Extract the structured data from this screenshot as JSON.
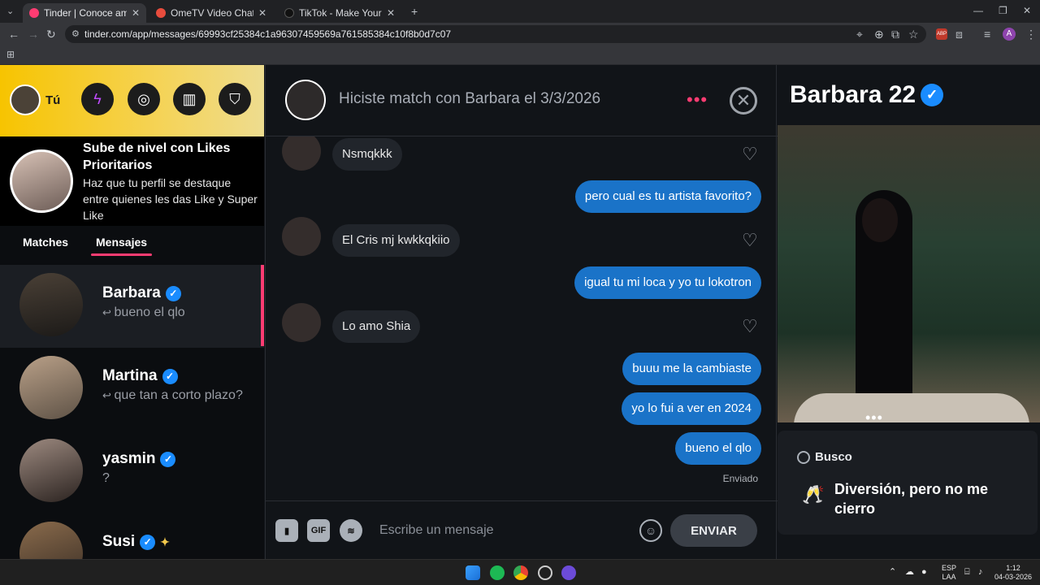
{
  "browser": {
    "tabs": [
      {
        "title": "Tinder | Conoce amigos y gente",
        "color": "#fe3c72"
      },
      {
        "title": "OmeTV Video Chat — Ome",
        "color": "#e84c3d"
      },
      {
        "title": "TikTok - Make Your Day",
        "color": "#111111"
      }
    ],
    "url": "tinder.com/app/messages/69993cf25384c1a96307459569a761585384c10f8b0d7c07",
    "new_tab": "+",
    "avatar_initial": "A"
  },
  "sidebar": {
    "user_label": "Tú",
    "promo_title": "Sube de nivel con Likes Prioritarios",
    "promo_text": "Haz que tu perfil se destaque entre quienes les das Like y Super Like",
    "tabs": [
      "Matches",
      "Mensajes"
    ],
    "conversations": [
      {
        "name": "Barbara",
        "preview": "bueno el qlo",
        "reply": true
      },
      {
        "name": "Martina",
        "preview": "que tan a corto plazo?",
        "reply": true
      },
      {
        "name": "yasmin",
        "preview": "?",
        "reply": false
      },
      {
        "name": "Susi",
        "preview": "",
        "reply": false
      }
    ]
  },
  "chat": {
    "header": "Hiciste match con Barbara el 3/3/2026",
    "messages": [
      {
        "dir": "in",
        "text": "Nsmqkkk"
      },
      {
        "dir": "out",
        "text": "pero cual es tu artista favorito?"
      },
      {
        "dir": "in",
        "text": "El Cris mj kwkkqkiio"
      },
      {
        "dir": "out",
        "text": "igual tu mi loca y yo tu lokotron"
      },
      {
        "dir": "in",
        "text": "Lo amo Shia"
      },
      {
        "dir": "out",
        "text": "buuu me la cambiaste"
      },
      {
        "dir": "out",
        "text": "yo lo fui a ver en 2024"
      },
      {
        "dir": "out",
        "text": "bueno el qlo"
      }
    ],
    "status": "Enviado",
    "input_placeholder": "Escribe un mensaje",
    "gif_label": "GIF",
    "send_label": "ENVIAR"
  },
  "profile": {
    "name_age": "Barbara 22",
    "looking_label": "Busco",
    "intent": "Diversión, pero no me cierro"
  },
  "taskbar": {
    "lang": "ESP",
    "lang2": "LAA",
    "time": "1:12",
    "date": "04-03-2026"
  }
}
